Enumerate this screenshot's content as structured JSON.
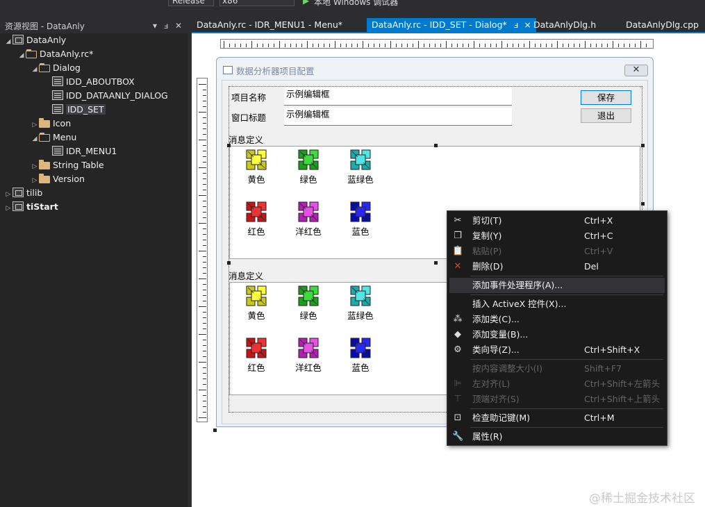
{
  "toolbar": {
    "config": "Release",
    "platform": "x86",
    "run_label": "本地 Windows 调试器"
  },
  "solution_pane": {
    "title": "资源视图 - DataAnly",
    "tree": [
      {
        "label": "DataAnly",
        "depth": 0,
        "arrow": "◢",
        "icon": "proj"
      },
      {
        "label": "DataAnly.rc*",
        "depth": 1,
        "arrow": "◢",
        "icon": "folder-open"
      },
      {
        "label": "Dialog",
        "depth": 2,
        "arrow": "◢",
        "icon": "folder-open"
      },
      {
        "label": "IDD_ABOUTBOX",
        "depth": 3,
        "arrow": "",
        "icon": "dlg"
      },
      {
        "label": "IDD_DATAANLY_DIALOG",
        "depth": 3,
        "arrow": "",
        "icon": "dlg"
      },
      {
        "label": "IDD_SET",
        "depth": 3,
        "arrow": "",
        "icon": "dlg",
        "selected": true
      },
      {
        "label": "Icon",
        "depth": 2,
        "arrow": "▷",
        "icon": "folder"
      },
      {
        "label": "Menu",
        "depth": 2,
        "arrow": "◢",
        "icon": "folder-open"
      },
      {
        "label": "IDR_MENU1",
        "depth": 3,
        "arrow": "",
        "icon": "dlg"
      },
      {
        "label": "String Table",
        "depth": 2,
        "arrow": "▷",
        "icon": "folder"
      },
      {
        "label": "Version",
        "depth": 2,
        "arrow": "▷",
        "icon": "folder"
      },
      {
        "label": "tilib",
        "depth": 0,
        "arrow": "▷",
        "icon": "proj"
      },
      {
        "label": "tiStart",
        "depth": 0,
        "arrow": "▷",
        "icon": "proj",
        "bold": true
      }
    ]
  },
  "tabs": [
    {
      "label": "DataAnly.rc - IDR_MENU1 - Menu*"
    },
    {
      "label": "DataAnly.rc - IDD_SET - Dialog*",
      "active": true,
      "pin": "ⅎ",
      "close": "×"
    },
    {
      "label": "DataAnlyDlg.h"
    },
    {
      "label": "DataAnlyDlg.cpp"
    }
  ],
  "dialog": {
    "title": "数据分析器项目配置",
    "close_glyph": "✕",
    "project_name_label": "项目名称",
    "project_name_value": "示例编辑框",
    "window_title_label": "窗口标题",
    "window_title_value": "示例编辑框",
    "save_button": "保存",
    "exit_button": "退出",
    "groups": [
      {
        "label": "消息定义",
        "items": [
          {
            "label": "黄色",
            "color": "#c8c81e",
            "hl": "#ffff3c"
          },
          {
            "label": "绿色",
            "color": "#19a019",
            "hl": "#3cdc3c"
          },
          {
            "label": "蓝绿色",
            "color": "#1eaaaa",
            "hl": "#50e6e6"
          },
          {
            "label": "红色",
            "color": "#c81414",
            "hl": "#f03232"
          },
          {
            "label": "洋红色",
            "color": "#b41eb4",
            "hl": "#e650e6"
          },
          {
            "label": "蓝色",
            "color": "#0a0ab4",
            "hl": "#2828f0"
          }
        ]
      },
      {
        "label": "消息定义",
        "items": [
          {
            "label": "黄色",
            "color": "#c8c81e",
            "hl": "#ffff3c"
          },
          {
            "label": "绿色",
            "color": "#19a019",
            "hl": "#3cdc3c"
          },
          {
            "label": "蓝绿色",
            "color": "#1eaaaa",
            "hl": "#50e6e6"
          },
          {
            "label": "红色",
            "color": "#c81414",
            "hl": "#f03232"
          },
          {
            "label": "洋红色",
            "color": "#b41eb4",
            "hl": "#e650e6"
          },
          {
            "label": "蓝色",
            "color": "#0a0ab4",
            "hl": "#2828f0"
          }
        ]
      }
    ]
  },
  "context_menu": [
    {
      "label": "剪切(T)",
      "shortcut": "Ctrl+X",
      "icon": "scissors-icon",
      "glyph": "✂"
    },
    {
      "label": "复制(Y)",
      "shortcut": "Ctrl+C",
      "icon": "copy-icon",
      "glyph": "❐"
    },
    {
      "label": "粘贴(P)",
      "shortcut": "Ctrl+V",
      "icon": "paste-icon",
      "glyph": "📋",
      "disabled": true
    },
    {
      "label": "删除(D)",
      "shortcut": "Del",
      "icon": "delete-icon",
      "glyph": "✕",
      "glyph_color": "#e8433c"
    },
    {
      "sep": true
    },
    {
      "label": "添加事件处理程序(A)...",
      "shortcut": "",
      "highlight": true
    },
    {
      "sep": true
    },
    {
      "label": "插入 ActiveX 控件(X)...",
      "shortcut": ""
    },
    {
      "label": "添加类(C)...",
      "shortcut": "",
      "icon": "add-class-icon",
      "glyph": "⁂"
    },
    {
      "label": "添加变量(B)...",
      "shortcut": "",
      "icon": "add-variable-icon",
      "glyph": "◆"
    },
    {
      "label": "类向导(Z)...",
      "shortcut": "Ctrl+Shift+X",
      "icon": "class-wizard-icon",
      "glyph": "⚙"
    },
    {
      "sep": true
    },
    {
      "label": "按内容调整大小(I)",
      "shortcut": "Shift+F7",
      "disabled": true
    },
    {
      "label": "左对齐(L)",
      "shortcut": "Ctrl+Shift+左箭头",
      "icon": "align-left-icon",
      "glyph": "⊫",
      "disabled": true
    },
    {
      "label": "顶端对齐(S)",
      "shortcut": "Ctrl+Shift+上箭头",
      "icon": "align-top-icon",
      "glyph": "⊤",
      "disabled": true
    },
    {
      "sep": true
    },
    {
      "label": "检查助记键(M)",
      "shortcut": "Ctrl+M",
      "icon": "check-mnemonics-icon",
      "glyph": "⊡"
    },
    {
      "sep": true
    },
    {
      "label": "属性(R)",
      "shortcut": "",
      "icon": "wrench-icon",
      "glyph": "🔧"
    }
  ],
  "watermark": "@稀土掘金技术社区"
}
